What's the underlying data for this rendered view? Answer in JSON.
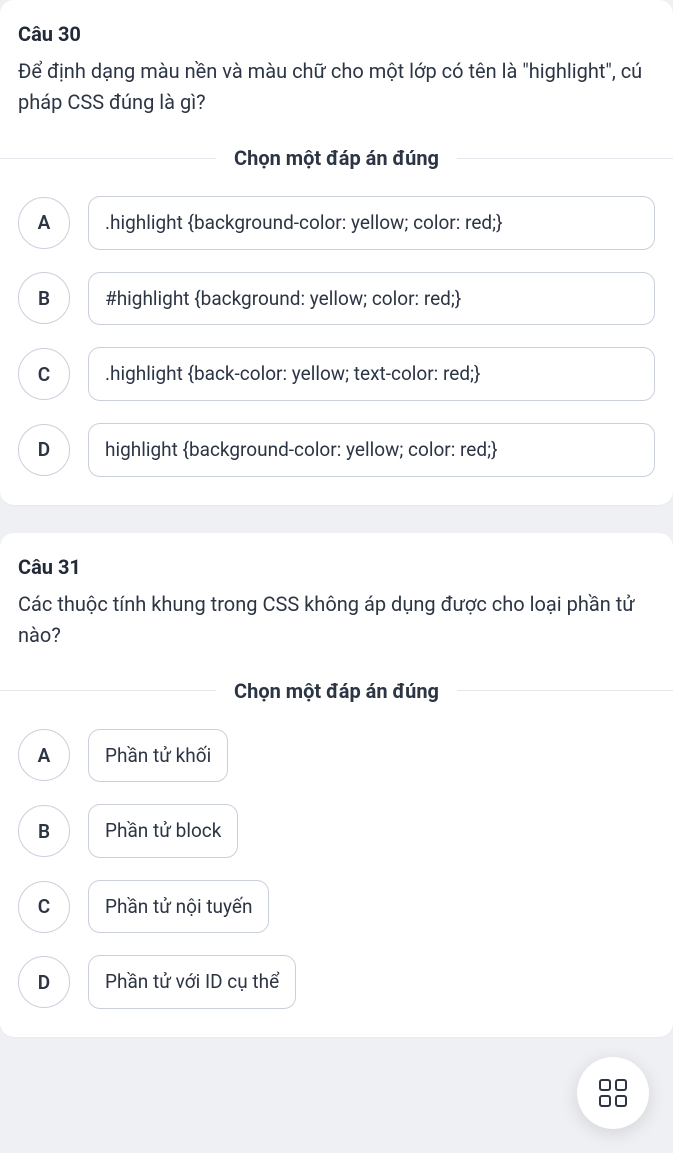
{
  "questions": [
    {
      "title": "Câu 30",
      "text": "Để định dạng màu nền và màu chữ cho một lớp có tên là \"highlight\", cú pháp CSS đúng là gì?",
      "prompt": "Chọn một đáp án đúng",
      "full_width_options": true,
      "options": [
        {
          "letter": "A",
          "text": ".highlight {background-color: yellow; color: red;}"
        },
        {
          "letter": "B",
          "text": "#highlight {background: yellow; color: red;}"
        },
        {
          "letter": "C",
          "text": ".highlight {back-color: yellow; text-color: red;}"
        },
        {
          "letter": "D",
          "text": "highlight {background-color: yellow; color: red;}"
        }
      ]
    },
    {
      "title": "Câu 31",
      "text": "Các thuộc tính khung trong CSS không áp dụng được cho loại phần tử nào?",
      "prompt": "Chọn một đáp án đúng",
      "full_width_options": false,
      "options": [
        {
          "letter": "A",
          "text": "Phần tử khối"
        },
        {
          "letter": "B",
          "text": "Phần tử block"
        },
        {
          "letter": "C",
          "text": "Phần tử nội tuyến"
        },
        {
          "letter": "D",
          "text": "Phần tử với ID cụ thể"
        }
      ]
    }
  ],
  "fab_icon": "grid-icon"
}
